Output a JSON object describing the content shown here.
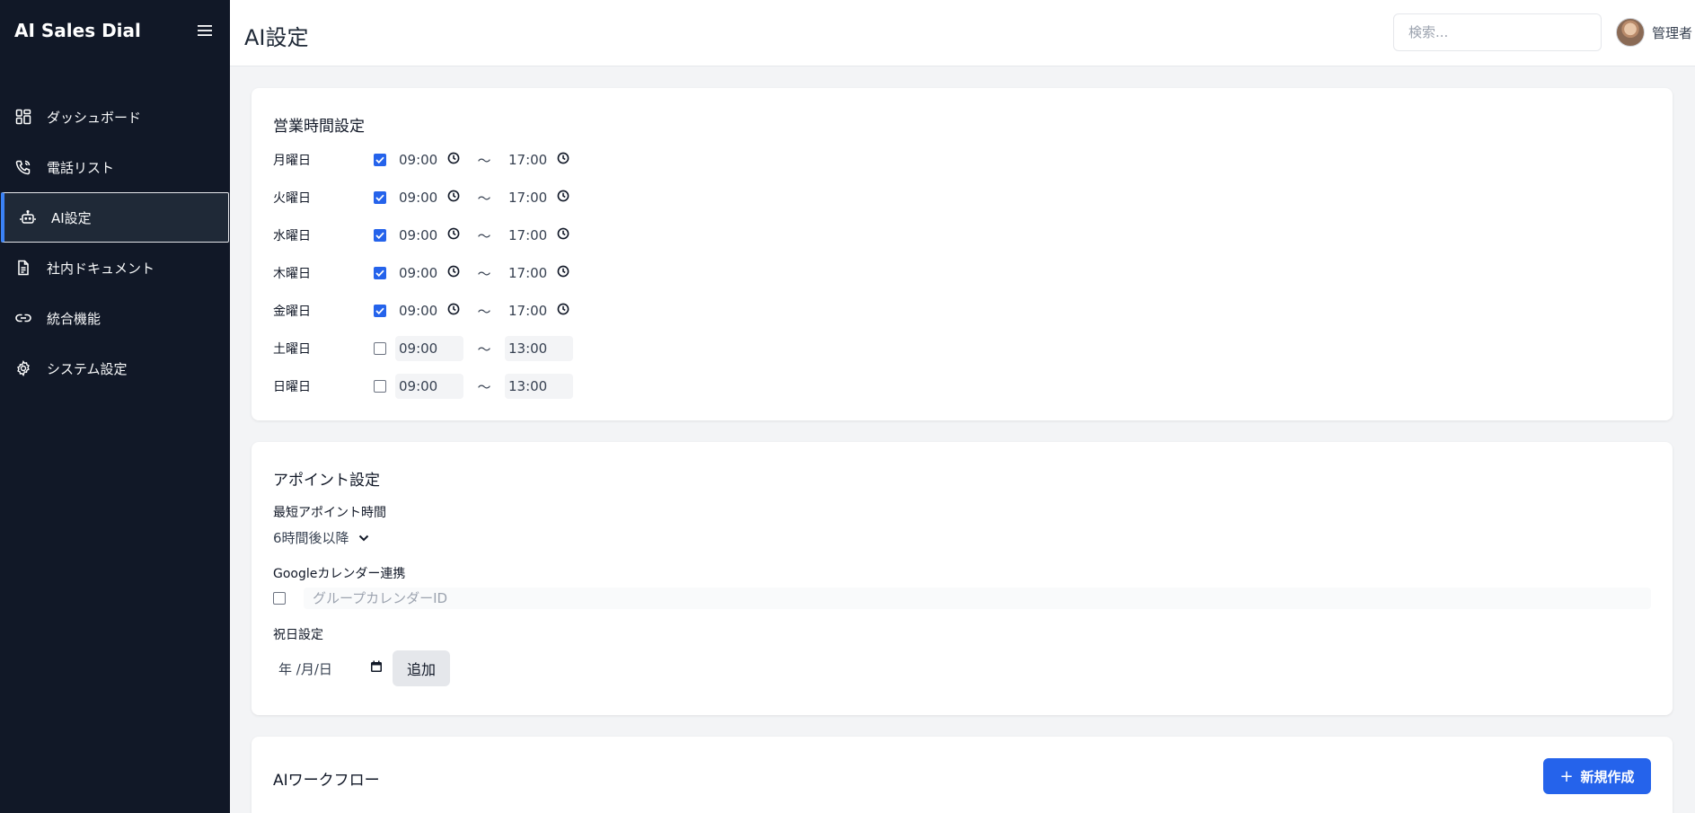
{
  "app": {
    "brand": "AI Sales Dial"
  },
  "header": {
    "title": "AI設定",
    "search_placeholder": "検索...",
    "user_name": "管理者"
  },
  "sidebar": {
    "items": [
      {
        "label": "ダッシュボード",
        "icon": "dashboard-icon",
        "active": false
      },
      {
        "label": "電話リスト",
        "icon": "phone-icon",
        "active": false
      },
      {
        "label": "AI設定",
        "icon": "robot-icon",
        "active": true
      },
      {
        "label": "社内ドキュメント",
        "icon": "document-icon",
        "active": false
      },
      {
        "label": "統合機能",
        "icon": "link-icon",
        "active": false
      },
      {
        "label": "システム設定",
        "icon": "gear-icon",
        "active": false
      }
    ]
  },
  "hours": {
    "title": "営業時間設定",
    "separator": "〜",
    "days": [
      {
        "label": "月曜日",
        "enabled": true,
        "start": "09:00",
        "end": "17:00"
      },
      {
        "label": "火曜日",
        "enabled": true,
        "start": "09:00",
        "end": "17:00"
      },
      {
        "label": "水曜日",
        "enabled": true,
        "start": "09:00",
        "end": "17:00"
      },
      {
        "label": "木曜日",
        "enabled": true,
        "start": "09:00",
        "end": "17:00"
      },
      {
        "label": "金曜日",
        "enabled": true,
        "start": "09:00",
        "end": "17:00"
      },
      {
        "label": "土曜日",
        "enabled": false,
        "start": "09:00",
        "end": "13:00"
      },
      {
        "label": "日曜日",
        "enabled": false,
        "start": "09:00",
        "end": "13:00"
      }
    ]
  },
  "appointment": {
    "title": "アポイント設定",
    "min_time_label": "最短アポイント時間",
    "min_time_value": "6時間後以降",
    "calendar_label": "Googleカレンダー連携",
    "calendar_placeholder": "グループカレンダーID",
    "holiday_label": "祝日設定",
    "date_placeholder": "年 /月/日",
    "add_label": "追加"
  },
  "workflow": {
    "title": "AIワークフロー",
    "new_label": "新規作成"
  },
  "colors": {
    "sidebar_bg": "#111827",
    "accent": "#2563eb",
    "page_bg": "#f3f4f6"
  }
}
